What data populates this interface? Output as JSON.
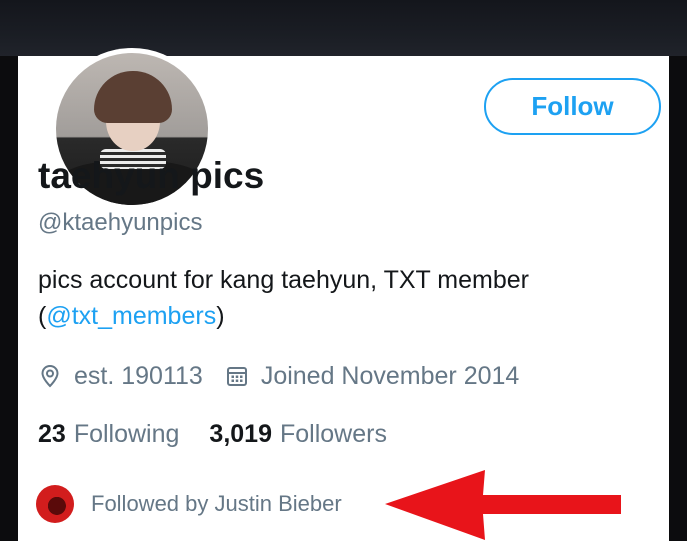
{
  "profile": {
    "name": "taehyun pics",
    "handle": "@ktaehyunpics",
    "bio_text": "pics account for kang taehyun, TXT member",
    "bio_open_paren": "(",
    "bio_mention": "@txt_members",
    "bio_close_paren": ")",
    "location": "est. 190113",
    "joined": "Joined November 2014"
  },
  "actions": {
    "follow_label": "Follow"
  },
  "stats": {
    "following_count": "23",
    "following_label": "Following",
    "followers_count": "3,019",
    "followers_label": "Followers"
  },
  "followed_by": {
    "text": "Followed by Justin Bieber"
  },
  "colors": {
    "accent": "#1da1f2",
    "text_primary": "#14171a",
    "text_secondary": "#657786",
    "annotation_arrow": "#e8141a"
  },
  "icons": {
    "location": "location-pin-icon",
    "calendar": "calendar-icon",
    "annotation": "red-arrow-icon"
  }
}
